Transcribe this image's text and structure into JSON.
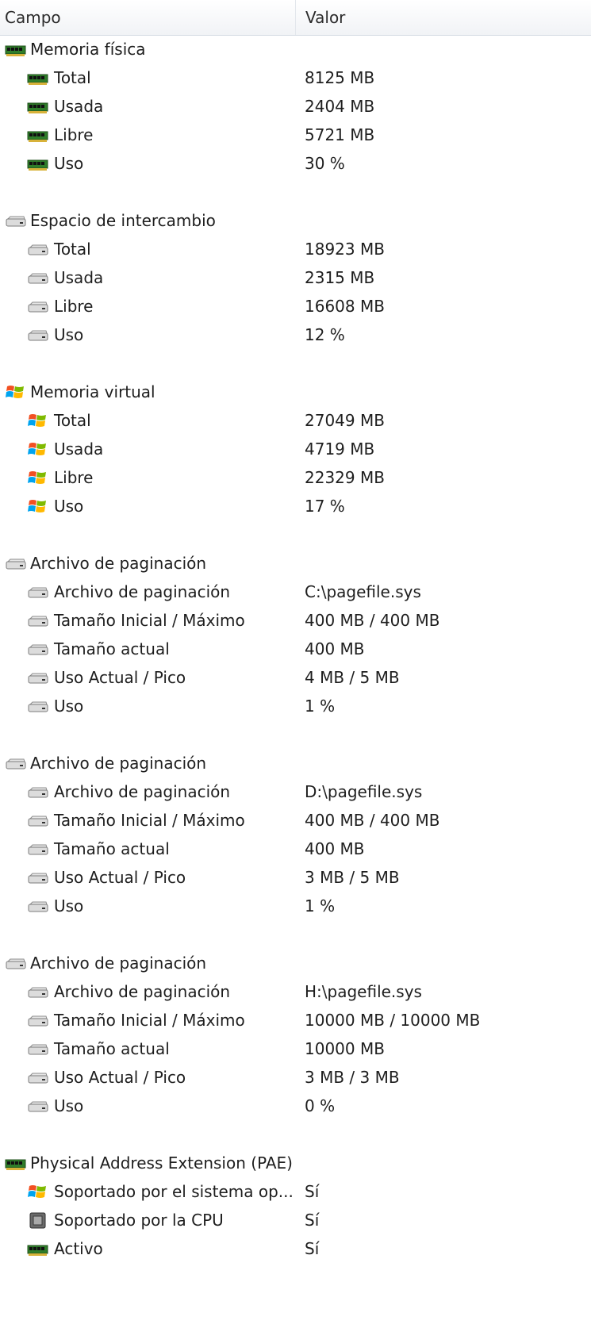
{
  "columns": {
    "field": "Campo",
    "value": "Valor"
  },
  "groups": [
    {
      "label": "Memoria física",
      "icon": "memory-module-icon",
      "items": [
        {
          "label": "Total",
          "value": "8125 MB",
          "icon": "memory-module-icon"
        },
        {
          "label": "Usada",
          "value": "2404 MB",
          "icon": "memory-module-icon"
        },
        {
          "label": "Libre",
          "value": "5721 MB",
          "icon": "memory-module-icon"
        },
        {
          "label": "Uso",
          "value": "30 %",
          "icon": "memory-module-icon"
        }
      ]
    },
    {
      "label": "Espacio de intercambio",
      "icon": "hard-drive-icon",
      "items": [
        {
          "label": "Total",
          "value": "18923 MB",
          "icon": "hard-drive-icon"
        },
        {
          "label": "Usada",
          "value": "2315 MB",
          "icon": "hard-drive-icon"
        },
        {
          "label": "Libre",
          "value": "16608 MB",
          "icon": "hard-drive-icon"
        },
        {
          "label": "Uso",
          "value": "12 %",
          "icon": "hard-drive-icon"
        }
      ]
    },
    {
      "label": "Memoria virtual",
      "icon": "windows-logo-icon",
      "items": [
        {
          "label": "Total",
          "value": "27049 MB",
          "icon": "windows-logo-icon"
        },
        {
          "label": "Usada",
          "value": "4719 MB",
          "icon": "windows-logo-icon"
        },
        {
          "label": "Libre",
          "value": "22329 MB",
          "icon": "windows-logo-icon"
        },
        {
          "label": "Uso",
          "value": "17 %",
          "icon": "windows-logo-icon"
        }
      ]
    },
    {
      "label": "Archivo de paginación",
      "icon": "hard-drive-icon",
      "items": [
        {
          "label": "Archivo de paginación",
          "value": "C:\\pagefile.sys",
          "icon": "hard-drive-icon"
        },
        {
          "label": "Tamaño Inicial / Máximo",
          "value": "400 MB / 400 MB",
          "icon": "hard-drive-icon"
        },
        {
          "label": "Tamaño actual",
          "value": "400 MB",
          "icon": "hard-drive-icon"
        },
        {
          "label": "Uso Actual / Pico",
          "value": "4 MB / 5 MB",
          "icon": "hard-drive-icon"
        },
        {
          "label": "Uso",
          "value": "1 %",
          "icon": "hard-drive-icon"
        }
      ]
    },
    {
      "label": "Archivo de paginación",
      "icon": "hard-drive-icon",
      "items": [
        {
          "label": "Archivo de paginación",
          "value": "D:\\pagefile.sys",
          "icon": "hard-drive-icon"
        },
        {
          "label": "Tamaño Inicial / Máximo",
          "value": "400 MB / 400 MB",
          "icon": "hard-drive-icon"
        },
        {
          "label": "Tamaño actual",
          "value": "400 MB",
          "icon": "hard-drive-icon"
        },
        {
          "label": "Uso Actual / Pico",
          "value": "3 MB / 5 MB",
          "icon": "hard-drive-icon"
        },
        {
          "label": "Uso",
          "value": "1 %",
          "icon": "hard-drive-icon"
        }
      ]
    },
    {
      "label": "Archivo de paginación",
      "icon": "hard-drive-icon",
      "items": [
        {
          "label": "Archivo de paginación",
          "value": "H:\\pagefile.sys",
          "icon": "hard-drive-icon"
        },
        {
          "label": "Tamaño Inicial / Máximo",
          "value": "10000 MB / 10000 MB",
          "icon": "hard-drive-icon"
        },
        {
          "label": "Tamaño actual",
          "value": "10000 MB",
          "icon": "hard-drive-icon"
        },
        {
          "label": "Uso Actual / Pico",
          "value": "3 MB / 3 MB",
          "icon": "hard-drive-icon"
        },
        {
          "label": "Uso",
          "value": "0 %",
          "icon": "hard-drive-icon"
        }
      ]
    },
    {
      "label": "Physical Address Extension (PAE)",
      "icon": "memory-module-icon",
      "items": [
        {
          "label": "Soportado por el sistema op...",
          "value": "Sí",
          "icon": "windows-logo-icon"
        },
        {
          "label": "Soportado por la CPU",
          "value": "Sí",
          "icon": "cpu-chip-icon"
        },
        {
          "label": "Activo",
          "value": "Sí",
          "icon": "memory-module-icon"
        }
      ]
    }
  ]
}
